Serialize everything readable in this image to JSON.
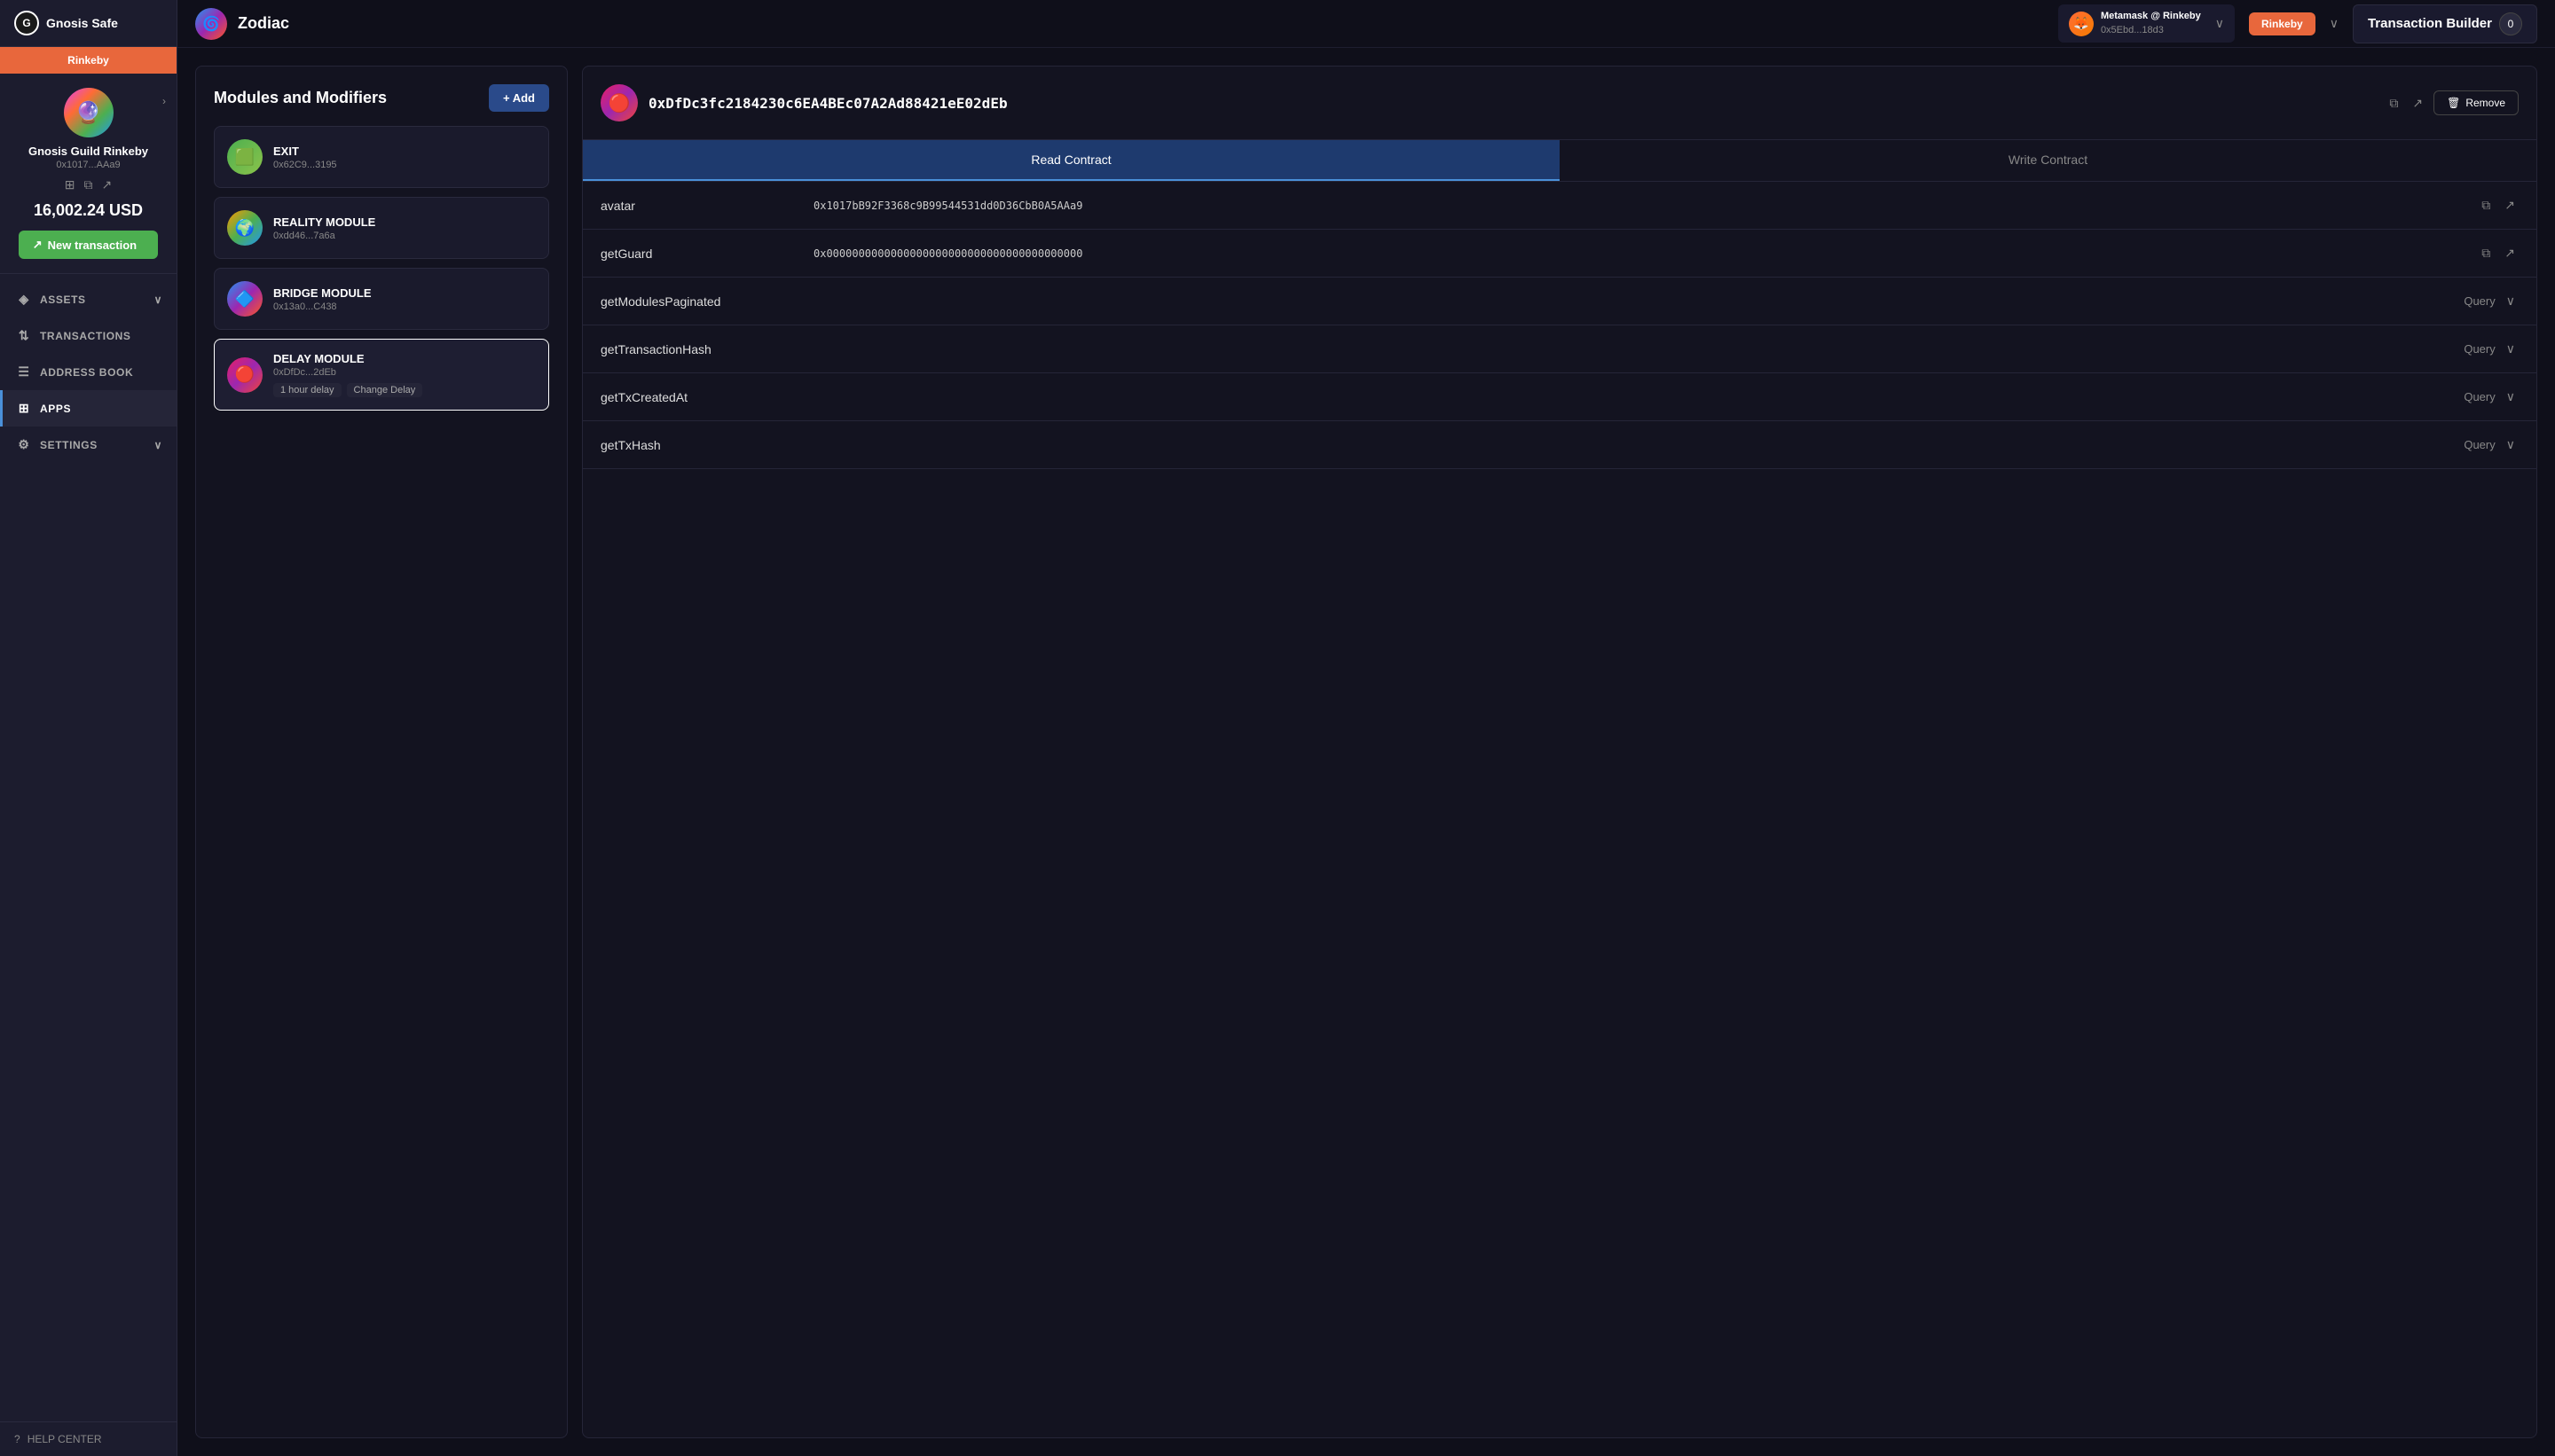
{
  "app": {
    "name": "Gnosis Safe",
    "network": "Rinkeby"
  },
  "wallet": {
    "name": "Metamask @ Rinkeby",
    "address": "0x5Ebd...18d3",
    "network_label": "Rinkeby"
  },
  "sidebar": {
    "network": "Rinkeby",
    "account_name": "Gnosis Guild Rinkeby",
    "account_address": "0x1017...AAa9",
    "balance": "16,002.24 USD",
    "new_tx_label": "New transaction",
    "nav_items": [
      {
        "id": "assets",
        "label": "ASSETS",
        "has_chevron": true
      },
      {
        "id": "transactions",
        "label": "TRANSACTIONS",
        "has_chevron": false
      },
      {
        "id": "address-book",
        "label": "ADDRESS BOOK",
        "has_chevron": false
      },
      {
        "id": "apps",
        "label": "APPS",
        "has_chevron": false,
        "active": true
      },
      {
        "id": "settings",
        "label": "SETTINGS",
        "has_chevron": true
      }
    ],
    "help_center": "HELP CENTER"
  },
  "topbar": {
    "zodiac_label": "Zodiac",
    "tx_builder_label": "Transaction Builder",
    "tx_badge": "0"
  },
  "modules_panel": {
    "title": "Modules and Modifiers",
    "add_label": "+ Add",
    "modules": [
      {
        "id": "exit",
        "name": "EXIT",
        "address": "0x62C9...3195",
        "icon_class": "exit",
        "tags": []
      },
      {
        "id": "reality",
        "name": "REALITY MODULE",
        "address": "0xdd46...7a6a",
        "icon_class": "reality",
        "tags": []
      },
      {
        "id": "bridge",
        "name": "BRIDGE MODULE",
        "address": "0x13a0...C438",
        "icon_class": "bridge",
        "tags": []
      },
      {
        "id": "delay",
        "name": "DELAY MODULE",
        "address": "0xDfDc...2dEb",
        "icon_class": "delay",
        "tags": [
          "1 hour delay",
          "Change Delay"
        ],
        "active": true
      }
    ]
  },
  "contract_panel": {
    "address": "0xDfDc3fc2184230c6EA4BEc07A2Ad88421eE02dEb",
    "tabs": [
      {
        "id": "read",
        "label": "Read Contract",
        "active": true
      },
      {
        "id": "write",
        "label": "Write Contract",
        "active": false
      }
    ],
    "rows": [
      {
        "id": "avatar",
        "label": "avatar",
        "value": "0x1017bB92F3368c9B99544531dd0D36CbB0A5AAa9",
        "type": "value",
        "has_copy": true,
        "has_link": true
      },
      {
        "id": "getGuard",
        "label": "getGuard",
        "value": "0x0000000000000000000000000000000000000000",
        "type": "value",
        "has_copy": true,
        "has_link": true
      },
      {
        "id": "getModulesPaginated",
        "label": "getModulesPaginated",
        "value": "",
        "type": "query",
        "query_label": "Query"
      },
      {
        "id": "getTransactionHash",
        "label": "getTransactionHash",
        "value": "",
        "type": "query",
        "query_label": "Query"
      },
      {
        "id": "getTxCreatedAt",
        "label": "getTxCreatedAt",
        "value": "",
        "type": "query",
        "query_label": "Query"
      },
      {
        "id": "getTxHash",
        "label": "getTxHash",
        "value": "",
        "type": "query",
        "query_label": "Query"
      }
    ],
    "remove_label": "Remove"
  }
}
